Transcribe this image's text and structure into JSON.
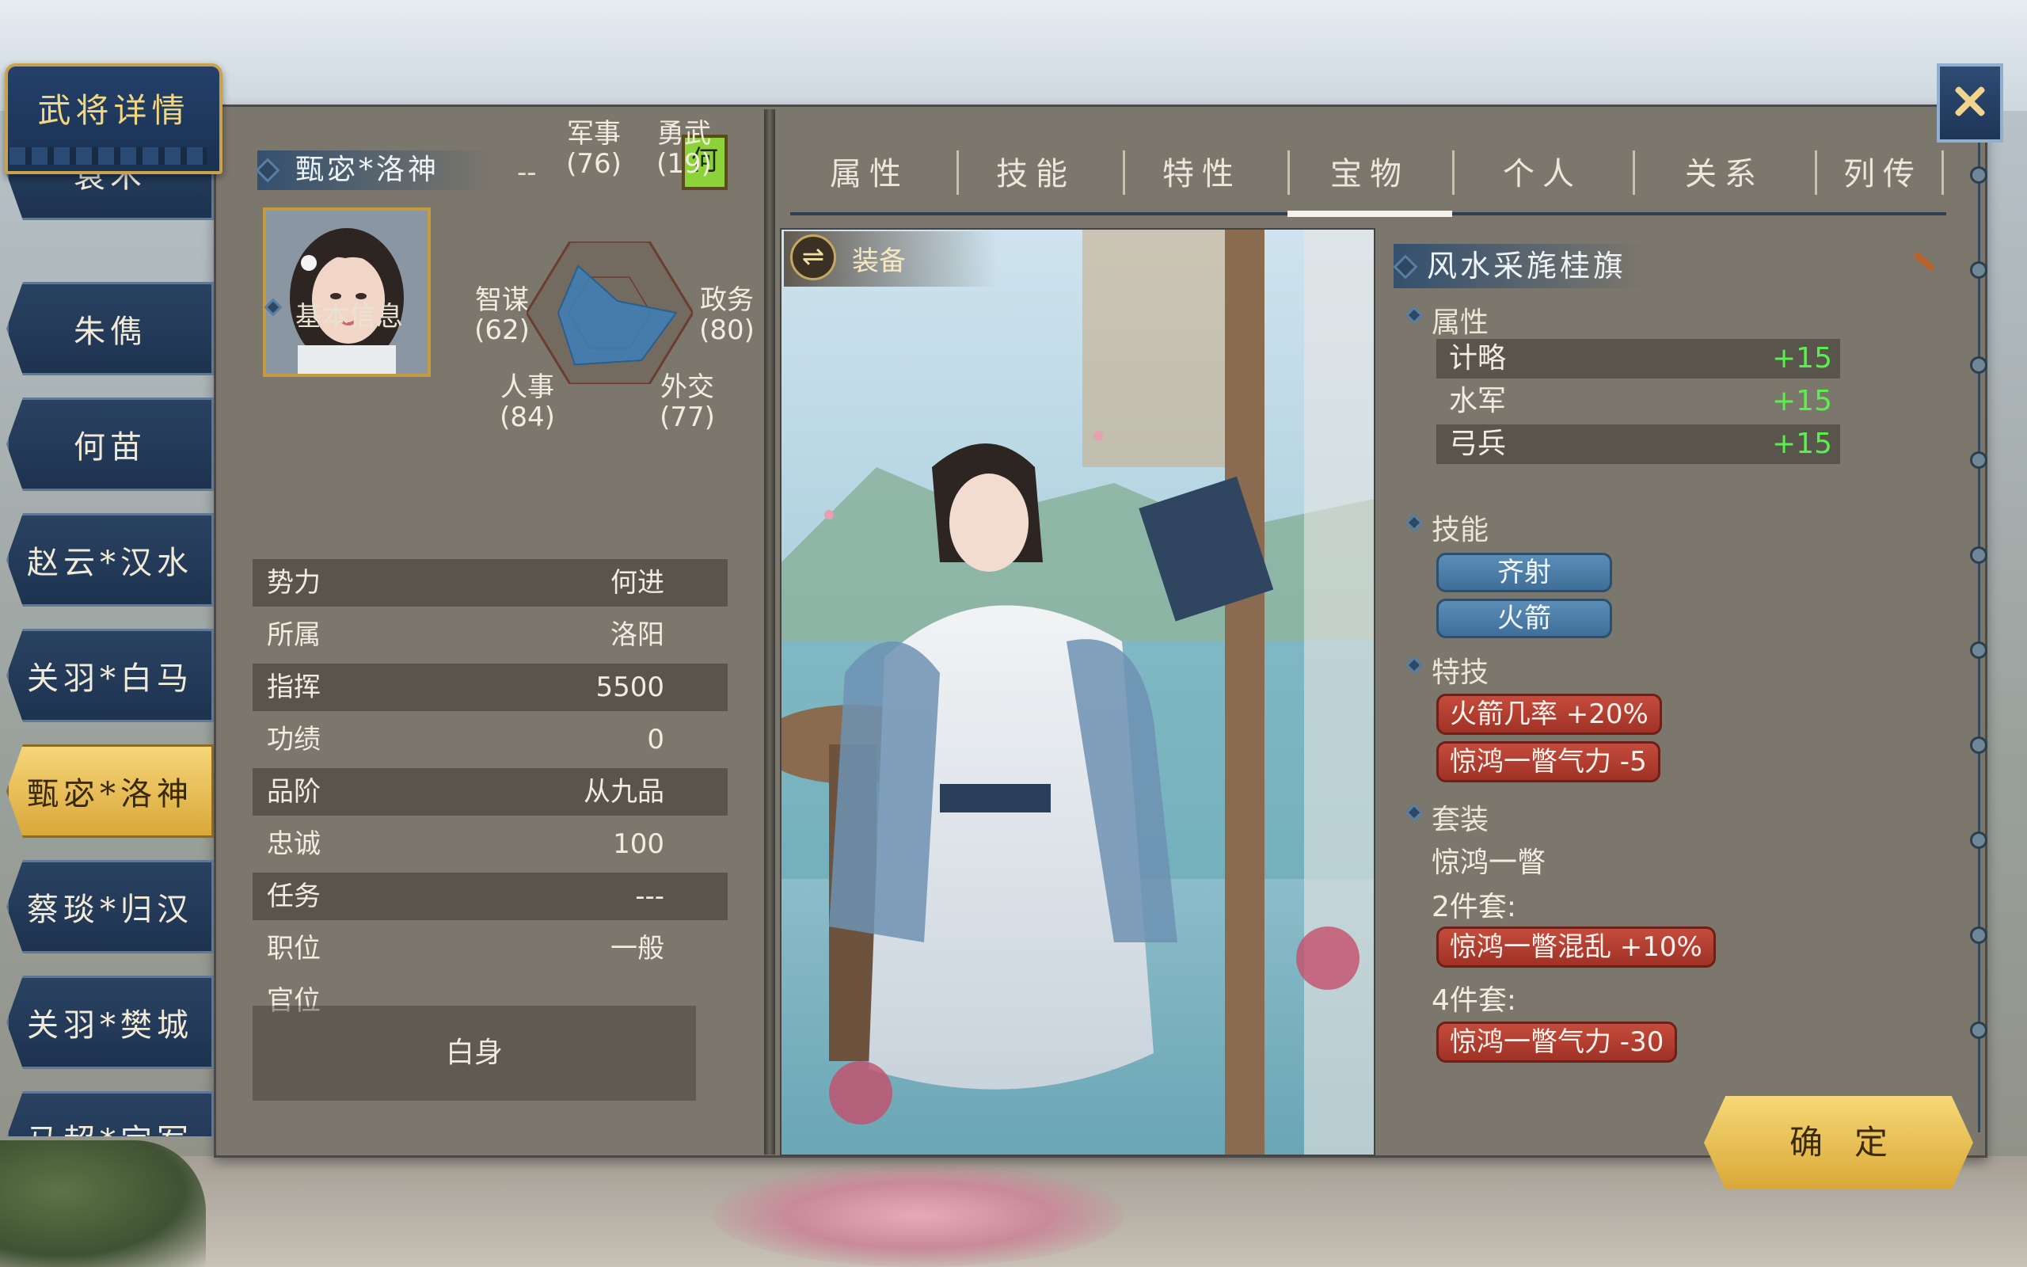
{
  "window": {
    "title": "武将详情"
  },
  "roster": [
    {
      "name": "袁术",
      "active": false
    },
    {
      "name": "朱儁",
      "active": false
    },
    {
      "name": "何苗",
      "active": false
    },
    {
      "name": "赵云*汉水",
      "active": false
    },
    {
      "name": "关羽*白马",
      "active": false
    },
    {
      "name": "甄宓*洛神",
      "active": true
    },
    {
      "name": "蔡琰*归汉",
      "active": false
    },
    {
      "name": "关羽*樊城",
      "active": false
    },
    {
      "name": "马超*定军",
      "active": false
    }
  ],
  "general": {
    "name": "甄宓*洛神",
    "placeholder": "--",
    "faction_tag": "何",
    "stats": {
      "military": {
        "label": "军事",
        "value": "(76)"
      },
      "valor": {
        "label": "勇武",
        "value": "(19)"
      },
      "intellect": {
        "label": "智谋",
        "value": "(62)"
      },
      "politics": {
        "label": "政务",
        "value": "(80)"
      },
      "personnel": {
        "label": "人事",
        "value": "(84)"
      },
      "diplomacy": {
        "label": "外交",
        "value": "(77)"
      }
    },
    "radar_values": [
      76,
      19,
      80,
      77,
      84,
      62
    ]
  },
  "basic_info": {
    "heading": "基本信息",
    "rows": [
      {
        "key": "势力",
        "value": "何进"
      },
      {
        "key": "所属",
        "value": "洛阳"
      },
      {
        "key": "指挥",
        "value": "5500"
      },
      {
        "key": "功绩",
        "value": "0"
      },
      {
        "key": "品阶",
        "value": "从九品"
      },
      {
        "key": "忠诚",
        "value": "100"
      },
      {
        "key": "任务",
        "value": "---"
      },
      {
        "key": "职位",
        "value": "一般"
      },
      {
        "key": "官位",
        "value": ""
      }
    ],
    "status": "白身"
  },
  "tabs": [
    {
      "label": "属性",
      "active": false
    },
    {
      "label": "技能",
      "active": false
    },
    {
      "label": "特性",
      "active": false
    },
    {
      "label": "宝物",
      "active": true
    },
    {
      "label": "个人",
      "active": false
    },
    {
      "label": "关系",
      "active": false
    },
    {
      "label": "列传",
      "active": false
    }
  ],
  "equip": {
    "label": "装备",
    "icon": "swap-icon"
  },
  "treasure": {
    "name": "风水采旄桂旗",
    "attributes_heading": "属性",
    "attributes": [
      {
        "key": "计略",
        "value": "+15"
      },
      {
        "key": "水军",
        "value": "+15"
      },
      {
        "key": "弓兵",
        "value": "+15"
      }
    ],
    "skills_heading": "技能",
    "skills": [
      "齐射",
      "火箭"
    ],
    "traits_heading": "特技",
    "traits": [
      "火箭几率 +20%",
      "惊鸿一瞥气力 -5"
    ],
    "set_heading": "套装",
    "set_name": "惊鸿一瞥",
    "set2_label": "2件套:",
    "set2_effect": "惊鸿一瞥混乱 +10%",
    "set4_label": "4件套:",
    "set4_effect": "惊鸿一瞥气力 -30"
  },
  "buttons": {
    "confirm": "确定",
    "close_icon": "close-icon"
  },
  "colors": {
    "accent_gold": "#d9a837",
    "navy": "#1d3350",
    "bonus_green": "#58f04a",
    "trait_red": "#b43e31"
  }
}
